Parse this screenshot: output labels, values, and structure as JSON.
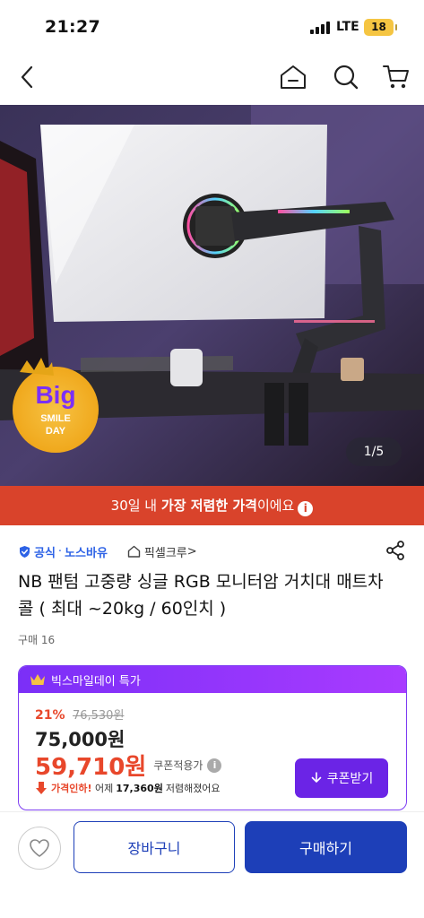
{
  "status_bar": {
    "time": "21:27",
    "network": "LTE",
    "battery": "18"
  },
  "hero": {
    "page_indicator": "1/5",
    "promo_logo_text": [
      "Big",
      "SMILE",
      "DAY"
    ],
    "promo_banner": {
      "prefix": "30일 내 ",
      "highlight": "가장 저렴한 가격",
      "suffix": "이에요",
      "info_icon": "i"
    }
  },
  "product": {
    "official_label": "공식",
    "separator": "·",
    "brand": "노스바유",
    "store": "픽셀크루",
    "store_chevron": ">",
    "title": "NB 팬텀 고중량 싱글 RGB 모니터암 거치대 매트차콜 ( 최대 ~20kg / 60인치 )",
    "purchases": "구매 16"
  },
  "price_card": {
    "header": "빅스마일데이 특가",
    "discount": "21%",
    "original_price": "76,530원",
    "sale_price": "75,000원",
    "final_price": "59,710원",
    "coupon_note": "쿠폰적용가",
    "coupon_info_icon": "i",
    "drop_prefix": "가격인하!",
    "drop_mid1": "어제",
    "drop_amount": "17,360원",
    "drop_suffix": "저렴해졌어요",
    "coupon_button": "쿠폰받기"
  },
  "bottom_bar": {
    "cart": "장바구니",
    "buy": "구매하기"
  },
  "colors": {
    "accent_purple": "#6b24e6",
    "accent_blue": "#1d3fb8",
    "sale_red": "#e8472b",
    "banner_red": "#d9432b"
  },
  "icons": [
    "back-icon",
    "home-icon",
    "search-icon",
    "cart-icon",
    "share-icon",
    "shield-check-icon",
    "store-icon",
    "crown-icon",
    "arrow-down-icon",
    "heart-icon",
    "info-icon"
  ]
}
